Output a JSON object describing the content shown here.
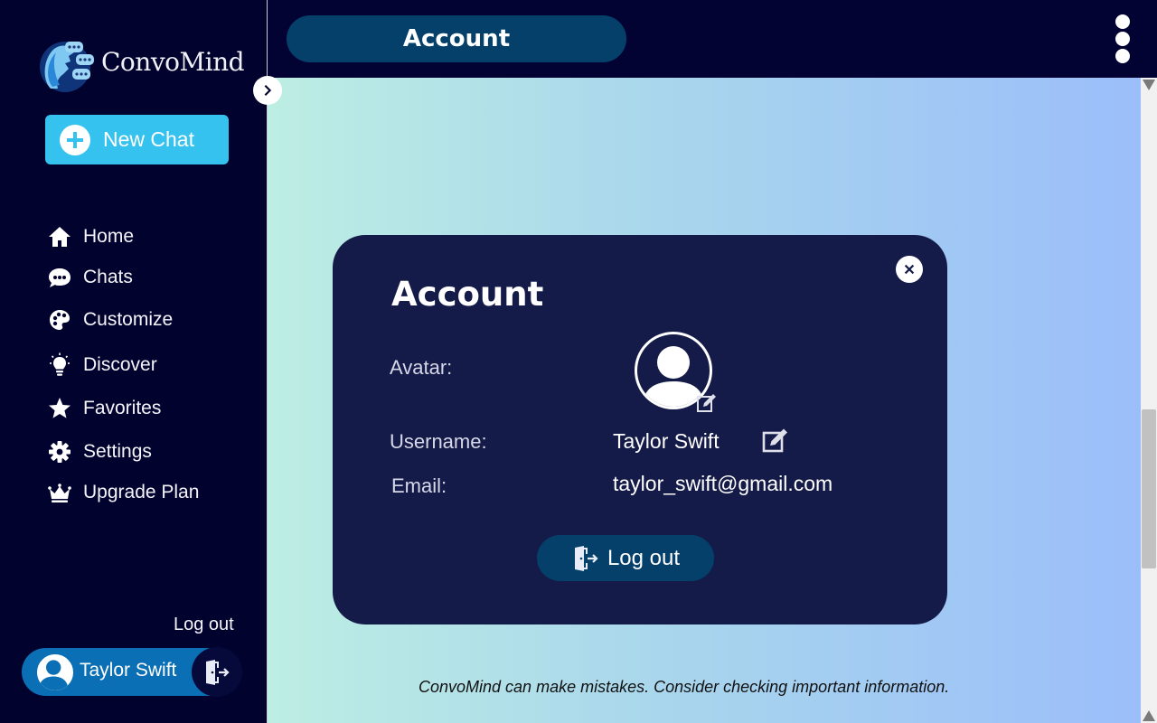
{
  "app": {
    "brand_name": "ConvoMind",
    "new_chat_label": "New Chat"
  },
  "sidebar": {
    "items": [
      {
        "label": "Home",
        "icon": "home-icon"
      },
      {
        "label": "Chats",
        "icon": "chat-bubble-icon"
      },
      {
        "label": "Customize",
        "icon": "palette-icon"
      },
      {
        "label": "Discover",
        "icon": "lightbulb-icon"
      },
      {
        "label": "Favorites",
        "icon": "star-icon"
      },
      {
        "label": "Settings",
        "icon": "gear-icon"
      },
      {
        "label": "Upgrade Plan",
        "icon": "crown-icon"
      }
    ],
    "logout_label": "Log out",
    "user_name": "Taylor Swift"
  },
  "header": {
    "title": "Account"
  },
  "account_card": {
    "heading": "Account",
    "avatar_label": "Avatar:",
    "username_label": "Username:",
    "username_value": "Taylor Swift",
    "email_label": "Email:",
    "email_value": "taylor_swift@gmail.com",
    "logout_label": "Log out"
  },
  "footer": {
    "disclaimer": "ConvoMind can make mistakes. Consider checking important information."
  },
  "colors": {
    "sidebar_bg": "#02022e",
    "accent": "#36c2ef",
    "pill": "#04406a",
    "card_bg": "#151b48",
    "user_pill": "#0a6fb4"
  }
}
